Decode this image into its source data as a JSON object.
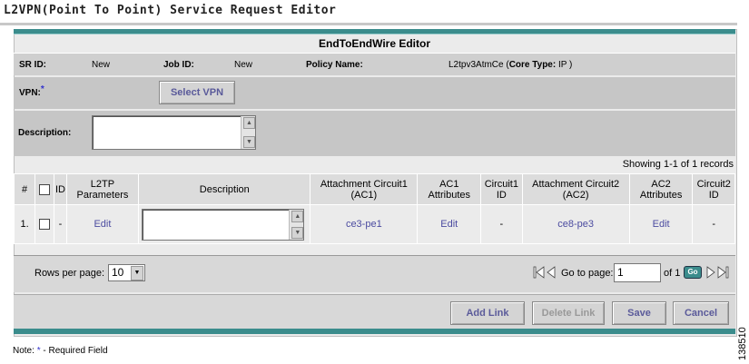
{
  "page": {
    "title": "L2VPN(Point To Point) Service Request Editor"
  },
  "editor": {
    "title": "EndToEndWire Editor"
  },
  "fields": {
    "sr_id_label": "SR ID:",
    "sr_id_value": "New",
    "job_id_label": "Job ID:",
    "job_id_value": "New",
    "policy_name_label": "Policy Name:",
    "policy_name_value": "L2tpv3AtmCe (",
    "core_type_label": "Core Type:",
    "core_type_value": "IP )",
    "vpn_label": "VPN:",
    "required_mark": "*",
    "select_vpn_label": "Select VPN",
    "description_label": "Description:",
    "description_value": ""
  },
  "table": {
    "showing": "Showing 1-1 of 1 records",
    "headers": [
      "#",
      "",
      "ID",
      "L2TP Parameters",
      "Description",
      "Attachment Circuit1 (AC1)",
      "AC1 Attributes",
      "Circuit1 ID",
      "Attachment Circuit2 (AC2)",
      "AC2 Attributes",
      "Circuit2 ID"
    ],
    "rows": [
      {
        "num": "1.",
        "id": "-",
        "l2tp": "Edit",
        "description": "",
        "ac1": "ce3-pe1",
        "ac1_attr": "Edit",
        "circuit1_id": "-",
        "ac2": "ce8-pe3",
        "ac2_attr": "Edit",
        "circuit2_id": "-"
      }
    ]
  },
  "pager": {
    "rows_per_page_label": "Rows per page:",
    "rows_per_page_value": "10",
    "goto_label": "Go to page:",
    "goto_value": "1",
    "of_label": "of 1",
    "go_label": "Go"
  },
  "actions": {
    "add_link": "Add Link",
    "delete_link": "Delete Link",
    "save": "Save",
    "cancel": "Cancel"
  },
  "note": {
    "prefix": "Note:",
    "star": "*",
    "text": "- Required Field"
  },
  "figure_id": "138510",
  "colors": {
    "teal": "#3b8c8c",
    "link": "#4b4ba0",
    "required": "#3333cc"
  }
}
